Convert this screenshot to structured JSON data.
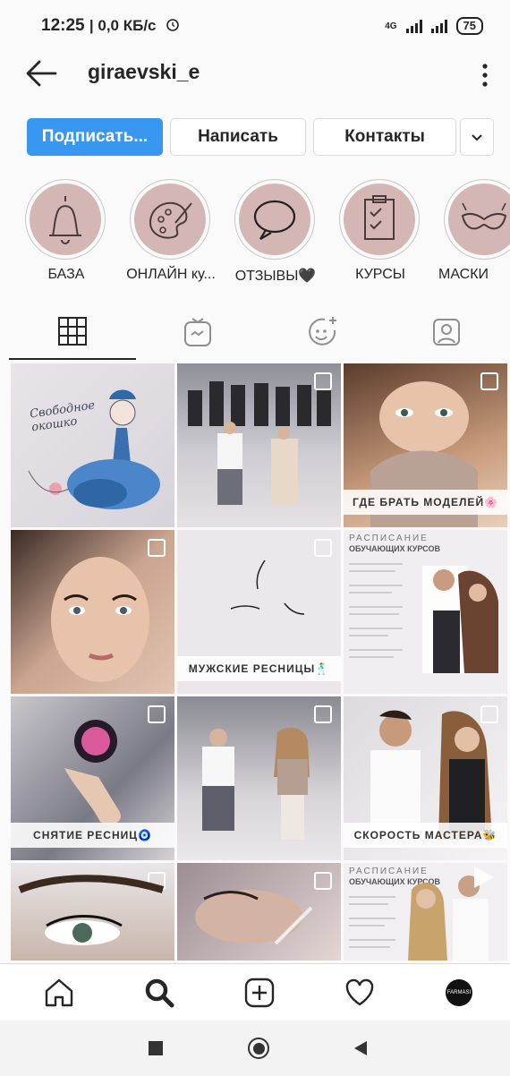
{
  "status_bar": {
    "time": "12:25",
    "speed": "| 0,0 КБ/с",
    "network": "4G",
    "battery": "75"
  },
  "header": {
    "username": "giraevski_e"
  },
  "actions": {
    "follow": "Подписать...",
    "message": "Написать",
    "contacts": "Контакты"
  },
  "highlights": [
    {
      "label": "БАЗА"
    },
    {
      "label": "ОНЛАЙН ку..."
    },
    {
      "label": "ОТЗЫВЫ🖤"
    },
    {
      "label": "КУРСЫ"
    },
    {
      "label": "МАСКИ"
    }
  ],
  "posts": [
    {
      "caption": "",
      "tile_text": "Свободное окошко"
    },
    {
      "caption": ""
    },
    {
      "caption": "ГДЕ БРАТЬ МОДЕЛЕЙ🌸"
    },
    {
      "caption": ""
    },
    {
      "caption": "МУЖСКИЕ РЕСНИЦЫ🕺"
    },
    {
      "caption": "",
      "tile_title": "РАСПИСАНИЕ",
      "tile_subtitle": "ОБУЧАЮЩИХ КУРСОВ"
    },
    {
      "caption": "СНЯТИЕ РЕСНИЦ🧿"
    },
    {
      "caption": ""
    },
    {
      "caption": "СКОРОСТЬ МАСТЕРА🐝"
    },
    {
      "caption": ""
    },
    {
      "caption": ""
    },
    {
      "caption": "",
      "tile_title": "РАСПИСАНИЕ",
      "tile_subtitle": "ОБУЧАЮЩИХ КУРСОВ"
    }
  ],
  "bottom_nav": {
    "avatar_text": "FARMASI"
  },
  "colors": {
    "accent": "#3897f0",
    "highlight_bg": "#d4b7b5"
  }
}
